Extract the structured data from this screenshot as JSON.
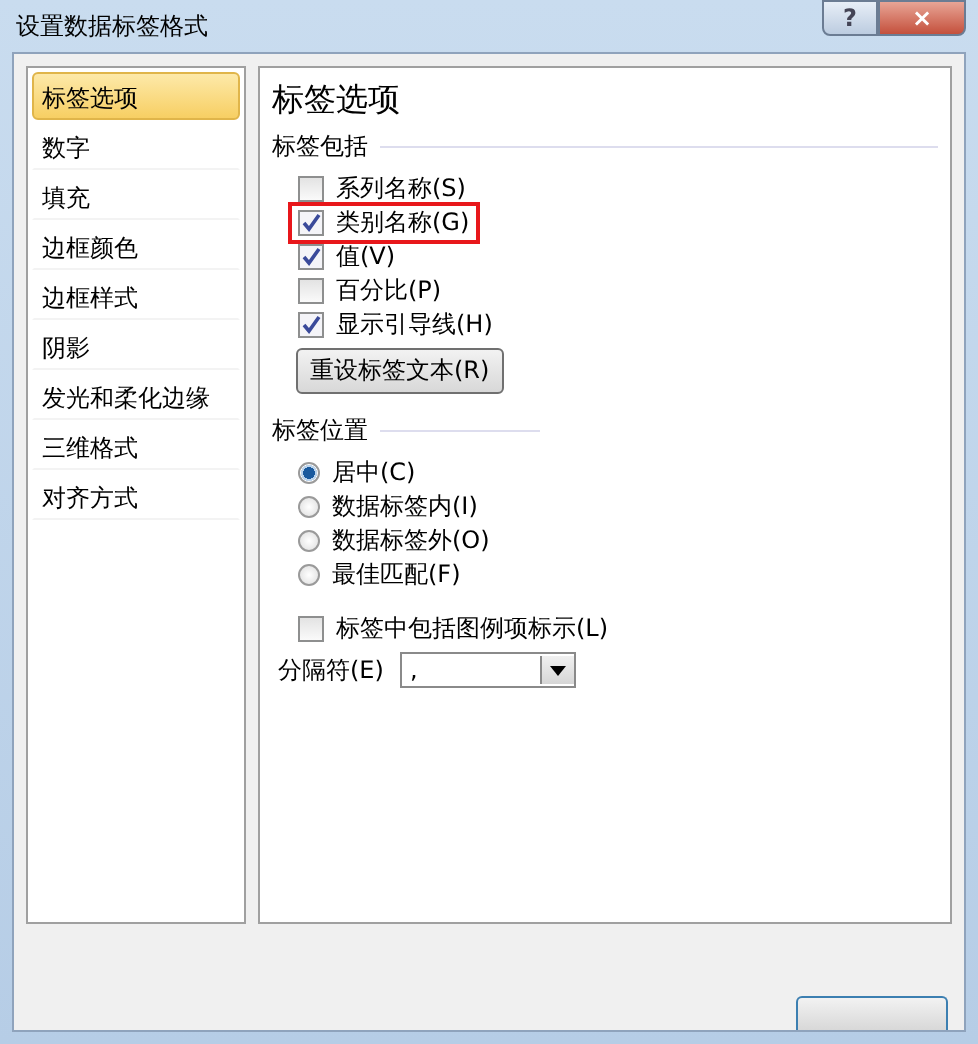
{
  "window": {
    "title": "设置数据标签格式",
    "help": "?",
    "close": "×"
  },
  "sidebar": {
    "items": [
      {
        "label": "标签选项",
        "selected": true
      },
      {
        "label": "数字",
        "selected": false
      },
      {
        "label": "填充",
        "selected": false
      },
      {
        "label": "边框颜色",
        "selected": false
      },
      {
        "label": "边框样式",
        "selected": false
      },
      {
        "label": "阴影",
        "selected": false
      },
      {
        "label": "发光和柔化边缘",
        "selected": false
      },
      {
        "label": "三维格式",
        "selected": false
      },
      {
        "label": "对齐方式",
        "selected": false
      }
    ]
  },
  "panel": {
    "title": "标签选项",
    "label_contains": {
      "heading": "标签包括",
      "options": [
        {
          "label": "系列名称(S)",
          "checked": false,
          "highlighted": false
        },
        {
          "label": "类别名称(G)",
          "checked": true,
          "highlighted": true
        },
        {
          "label": "值(V)",
          "checked": true,
          "highlighted": false
        },
        {
          "label": "百分比(P)",
          "checked": false,
          "highlighted": false
        },
        {
          "label": "显示引导线(H)",
          "checked": true,
          "highlighted": false
        }
      ],
      "reset_button": "重设标签文本(R)"
    },
    "label_position": {
      "heading": "标签位置",
      "options": [
        {
          "label": "居中(C)",
          "selected": true
        },
        {
          "label": "数据标签内(I)",
          "selected": false
        },
        {
          "label": "数据标签外(O)",
          "selected": false
        },
        {
          "label": "最佳匹配(F)",
          "selected": false
        }
      ]
    },
    "legend_key": {
      "label": "标签中包括图例项标示(L)",
      "checked": false
    },
    "separator": {
      "label": "分隔符(E)",
      "value": ","
    }
  }
}
